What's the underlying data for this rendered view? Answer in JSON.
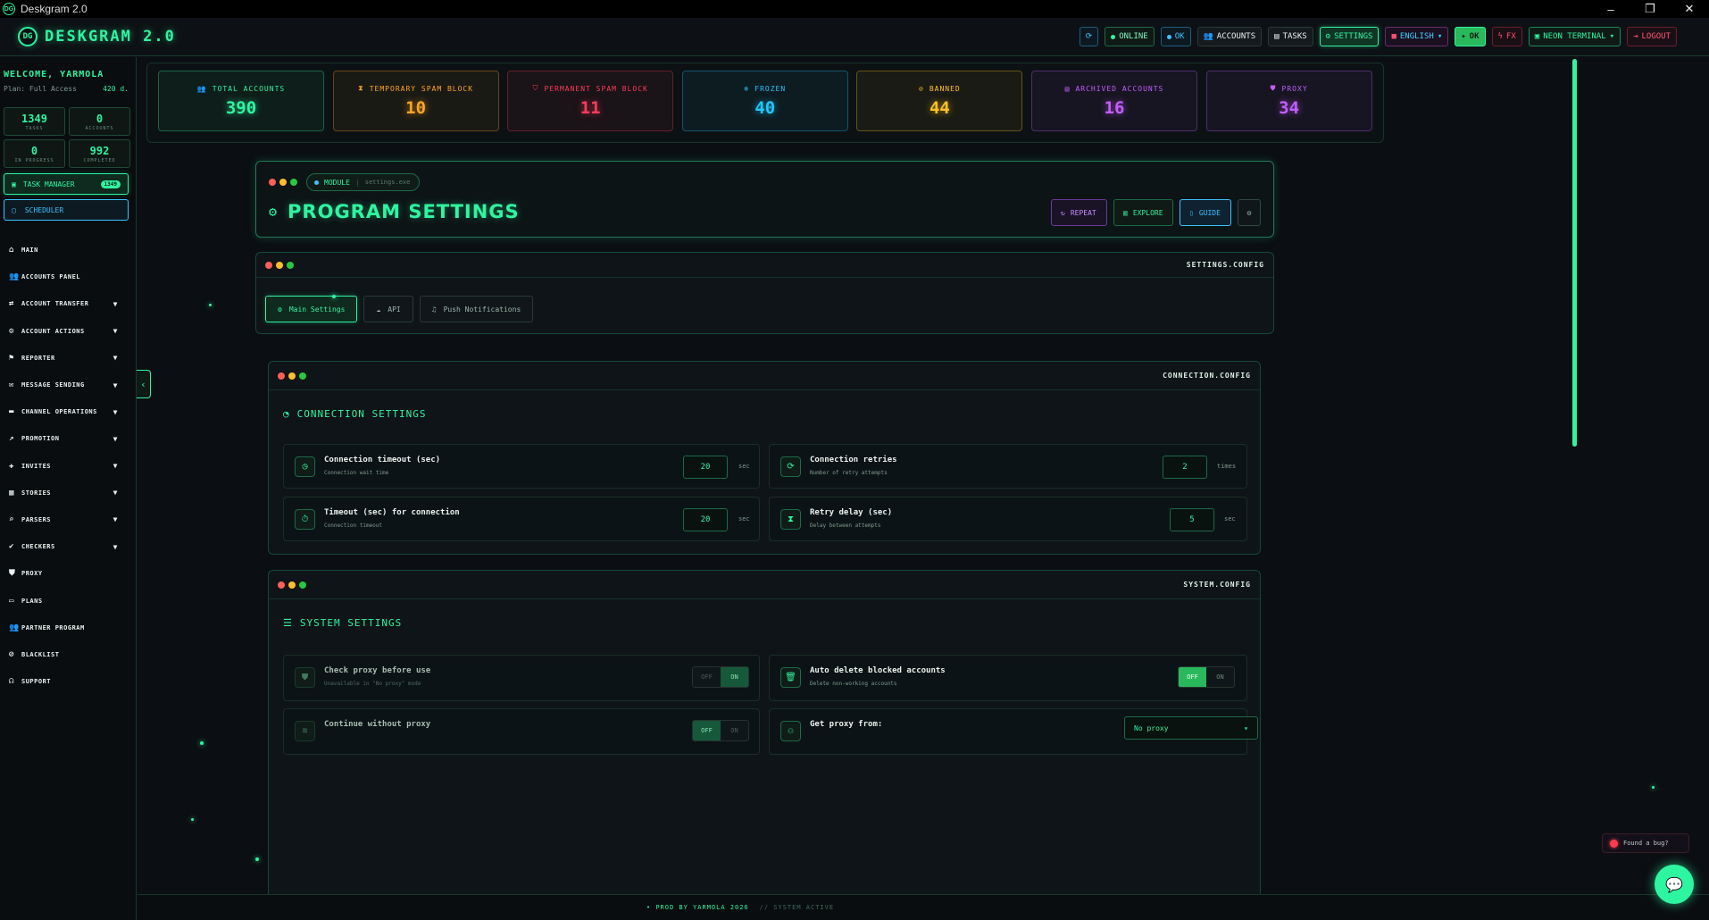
{
  "window": {
    "title": "Deskgram 2.0",
    "controls": [
      "–",
      "❐",
      "✕"
    ]
  },
  "header": {
    "brand": "DESKGRAM 2.0",
    "refresh_icon": "refresh-icon",
    "online": "ONLINE",
    "ok": "OK",
    "accounts": "ACCOUNTS",
    "tasks": "TASKS",
    "settings": "SETTINGS",
    "language": "ENGLISH",
    "ok2": "OK",
    "fx": "FX",
    "theme": "NEON TERMINAL",
    "logout": "LOGOUT"
  },
  "sidebar": {
    "welcome": "WELCOME, YARMOLA",
    "plan_label": "Plan: Full Access",
    "plan_days": "420 d.",
    "stats": [
      {
        "value": "1349",
        "label": "TASKS"
      },
      {
        "value": "0",
        "label": "ACCOUNTS"
      },
      {
        "value": "0",
        "label": "IN PROGRESS"
      },
      {
        "value": "992",
        "label": "COMPLETED"
      }
    ],
    "task_manager": "TASK MANAGER",
    "task_manager_badge": "1349",
    "scheduler": "SCHEDULER",
    "nav": [
      {
        "label": "MAIN",
        "icon": "home-icon"
      },
      {
        "label": "ACCOUNTS PANEL",
        "icon": "users-icon"
      },
      {
        "label": "ACCOUNT TRANSFER",
        "icon": "user-transfer-icon"
      },
      {
        "label": "ACCOUNT ACTIONS",
        "icon": "user-gear-icon"
      },
      {
        "label": "REPORTER",
        "icon": "flag-icon"
      },
      {
        "label": "MESSAGE SENDING",
        "icon": "message-icon"
      },
      {
        "label": "CHANNEL OPERATIONS",
        "icon": "channel-icon"
      },
      {
        "label": "PROMOTION",
        "icon": "chart-line-icon"
      },
      {
        "label": "INVITES",
        "icon": "invite-icon"
      },
      {
        "label": "STORIES",
        "icon": "stories-icon"
      },
      {
        "label": "PARSERS",
        "icon": "search-icon"
      },
      {
        "label": "CHECKERS",
        "icon": "check-circle-icon"
      },
      {
        "label": "PROXY",
        "icon": "shield-icon"
      },
      {
        "label": "PLANS",
        "icon": "plans-icon"
      },
      {
        "label": "PARTNER PROGRAM",
        "icon": "partner-icon"
      },
      {
        "label": "BLACKLIST",
        "icon": "user-block-icon"
      },
      {
        "label": "SUPPORT",
        "icon": "headset-icon"
      }
    ]
  },
  "kpis": [
    {
      "label": "TOTAL ACCOUNTS",
      "value": "390",
      "color": "#2ef5a0",
      "icon": "users-icon"
    },
    {
      "label": "TEMPORARY SPAM BLOCK",
      "value": "10",
      "color": "#ffa51f",
      "icon": "hourglass-icon"
    },
    {
      "label": "PERMANENT SPAM BLOCK",
      "value": "11",
      "color": "#ff3b5c",
      "icon": "shield-alert-icon"
    },
    {
      "label": "FROZEN",
      "value": "40",
      "color": "#22c6ff",
      "icon": "snowflake-icon"
    },
    {
      "label": "BANNED",
      "value": "44",
      "color": "#ffc21f",
      "icon": "ban-icon"
    },
    {
      "label": "ARCHIVED ACCOUNTS",
      "value": "16",
      "color": "#c45cff",
      "icon": "archive-icon"
    },
    {
      "label": "PROXY",
      "value": "34",
      "color": "#c45cff",
      "icon": "shield-icon"
    }
  ],
  "program": {
    "module": "MODULE",
    "file": "settings.exe",
    "title": "PROGRAM SETTINGS",
    "repeat": "REPEAT",
    "explore": "EXPLORE",
    "guide": "GUIDE"
  },
  "settings_window": {
    "title": "SETTINGS.CONFIG",
    "tabs": [
      "Main Settings",
      "API",
      "Push Notifications"
    ]
  },
  "connection": {
    "window_title": "CONNECTION.CONFIG",
    "section_title": "CONNECTION SETTINGS",
    "rows": [
      {
        "title": "Connection timeout (sec)",
        "sub": "Connection wait time",
        "value": "20",
        "unit": "sec"
      },
      {
        "title": "Connection retries",
        "sub": "Number of retry attempts",
        "value": "2",
        "unit": "times"
      },
      {
        "title": "Timeout (sec) for connection",
        "sub": "Connection timeout",
        "value": "20",
        "unit": "sec"
      },
      {
        "title": "Retry delay (sec)",
        "sub": "Delay between attempts",
        "value": "5",
        "unit": "sec"
      }
    ]
  },
  "system": {
    "window_title": "SYSTEM.CONFIG",
    "section_title": "SYSTEM SETTINGS",
    "off": "OFF",
    "on": "ON",
    "check_proxy": {
      "title": "Check proxy before use",
      "sub": "Unavailable in \"No proxy\" mode",
      "state": "ON"
    },
    "auto_delete": {
      "title": "Auto delete blocked accounts",
      "sub": "Delete non-working accounts",
      "state": "OFF"
    },
    "continue_proxy": {
      "title": "Continue without proxy",
      "state": "OFF"
    },
    "get_proxy": {
      "title": "Get proxy from:",
      "value": "No proxy"
    }
  },
  "footer": {
    "prod": "PROD BY YARMOLA 2026",
    "status": "// SYSTEM ACTIVE"
  },
  "bug_button": "Found a bug?"
}
